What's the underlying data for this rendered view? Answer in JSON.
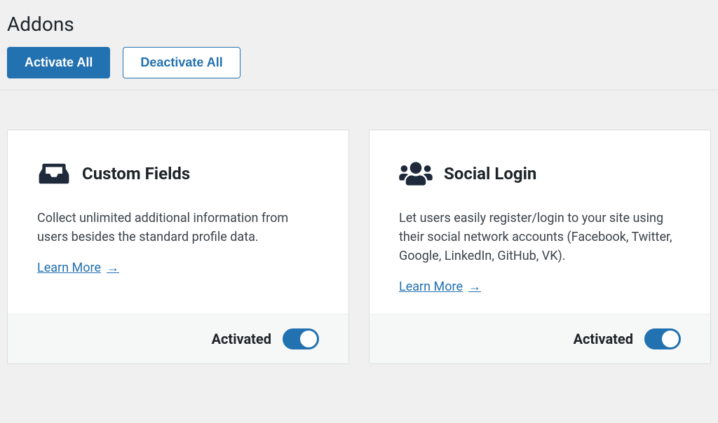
{
  "page_title": "Addons",
  "actions": {
    "activate_all": "Activate All",
    "deactivate_all": "Deactivate All"
  },
  "addons": [
    {
      "title": "Custom Fields",
      "description": "Collect unlimited additional information from users besides the standard profile data.",
      "learn_more": "Learn More",
      "status_label": "Activated",
      "activated": true,
      "icon": "inbox"
    },
    {
      "title": "Social Login",
      "description": "Let users easily register/login to your site using their social network accounts (Facebook, Twitter, Google, LinkedIn, GitHub, VK).",
      "learn_more": "Learn More",
      "status_label": "Activated",
      "activated": true,
      "icon": "users"
    }
  ]
}
